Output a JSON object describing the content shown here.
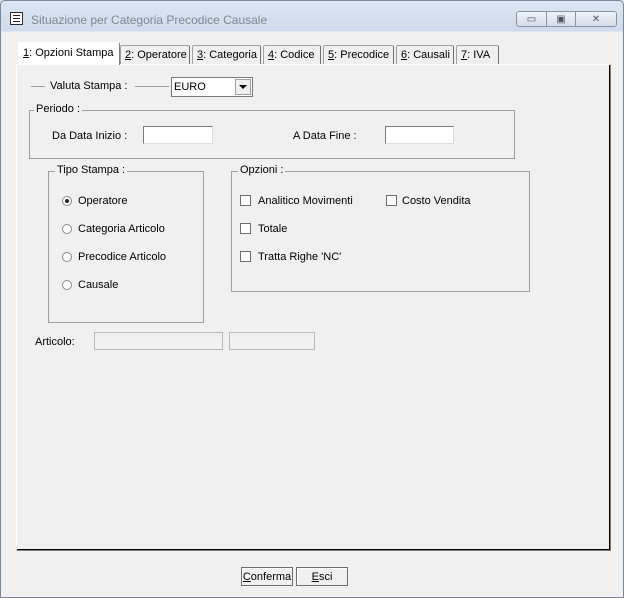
{
  "window": {
    "title": "Situazione per Categoria Precodice Causale",
    "caption_buttons": {
      "minimize": "▭",
      "maximize": "▣",
      "close": "✕"
    }
  },
  "tabs": [
    {
      "key": "1",
      "label": ": Opzioni Stampa",
      "active": true
    },
    {
      "key": "2",
      "label": ": Operatore"
    },
    {
      "key": "3",
      "label": ": Categoria"
    },
    {
      "key": "4",
      "label": ": Codice"
    },
    {
      "key": "5",
      "label": ": Precodice"
    },
    {
      "key": "6",
      "label": ": Causali"
    },
    {
      "key": "7",
      "label": ": IVA"
    }
  ],
  "valuta": {
    "label": "Valuta Stampa :",
    "value": "EURO"
  },
  "periodo": {
    "legend": "Periodo :",
    "start_label": "Da Data Inizio :",
    "start_value": "",
    "end_label": "A Data Fine :",
    "end_value": ""
  },
  "tipo_stampa": {
    "legend": "Tipo Stampa :",
    "options": [
      "Operatore",
      "Categoria Articolo",
      "Precodice Articolo",
      "Causale"
    ],
    "selected": "Operatore"
  },
  "opzioni": {
    "legend": "Opzioni :",
    "analitico": "Analitico Movimenti",
    "costo_vendita": "Costo Vendita",
    "totale": "Totale",
    "tratta_righe": "Tratta Righe 'NC'"
  },
  "articolo": {
    "label": "Articolo:",
    "value1": "",
    "value2": ""
  },
  "buttons": {
    "conferma_key": "C",
    "conferma_rest": "onferma",
    "esci_key": "E",
    "esci_rest": "sci"
  }
}
